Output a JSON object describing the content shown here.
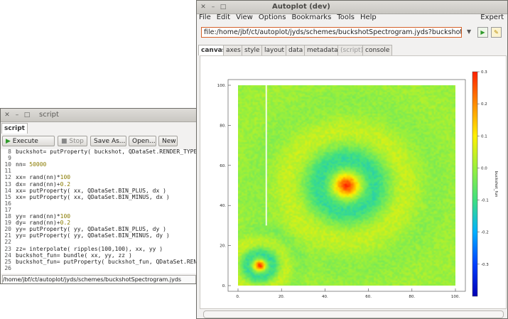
{
  "script_window": {
    "title": "script",
    "tab_label": "script",
    "buttons": {
      "execute": "Execute",
      "stop": "Stop",
      "save_as": "Save As...",
      "open": "Open...",
      "new": "New"
    },
    "code_lines": [
      {
        "n": "8",
        "text": "buckshot= putProperty( buckshot, QDataSet.RENDER_TYPE"
      },
      {
        "n": "9",
        "text": ""
      },
      {
        "n": "10",
        "text": "nn= 50000"
      },
      {
        "n": "11",
        "text": ""
      },
      {
        "n": "12",
        "text": "xx= rand(nn)*100"
      },
      {
        "n": "13",
        "text": "dx= rand(nn)+0.2"
      },
      {
        "n": "14",
        "text": "xx= putProperty( xx, QDataSet.BIN_PLUS, dx )"
      },
      {
        "n": "15",
        "text": "xx= putProperty( xx, QDataSet.BIN_MINUS, dx )"
      },
      {
        "n": "16",
        "text": ""
      },
      {
        "n": "17",
        "text": ""
      },
      {
        "n": "18",
        "text": "yy= rand(nn)*100"
      },
      {
        "n": "19",
        "text": "dy= rand(nn)+0.2"
      },
      {
        "n": "20",
        "text": "yy= putProperty( yy, QDataSet.BIN_PLUS, dy )"
      },
      {
        "n": "21",
        "text": "yy= putProperty( yy, QDataSet.BIN_MINUS, dy )"
      },
      {
        "n": "22",
        "text": ""
      },
      {
        "n": "23",
        "text": "zz= interpolate( ripples(100,100), xx, yy )"
      },
      {
        "n": "24",
        "text": "buckshot_fun= bundle( xx, yy, zz )"
      },
      {
        "n": "25",
        "text": "buckshot_fun= putProperty( buckshot_fun, QDataSet.REN"
      },
      {
        "n": "26",
        "text": ""
      }
    ],
    "status_path": "/home/jbf/ct/autoplot/jyds/schemes/buckshotSpectrogram.jyds"
  },
  "autoplot_window": {
    "title": "Autoplot (dev)",
    "menu": [
      "File",
      "Edit",
      "View",
      "Options",
      "Bookmarks",
      "Tools",
      "Help"
    ],
    "expert_label": "Expert",
    "address_value": "file:/home/jbf/ct/autoplot/jyds/schemes/buckshotSpectrogram.jyds?buckshot_fun",
    "tabs": [
      {
        "label": "canvas",
        "active": true,
        "disabled": false
      },
      {
        "label": "axes",
        "active": false,
        "disabled": false
      },
      {
        "label": "style",
        "active": false,
        "disabled": false
      },
      {
        "label": "layout",
        "active": false,
        "disabled": false
      },
      {
        "label": "data",
        "active": false,
        "disabled": false
      },
      {
        "label": "metadata",
        "active": false,
        "disabled": false
      },
      {
        "label": "(script)",
        "active": false,
        "disabled": true
      },
      {
        "label": "console",
        "active": false,
        "disabled": false
      }
    ]
  },
  "chart_data": {
    "type": "heatmap",
    "x_ticks": [
      "0.",
      "20.",
      "40.",
      "60.",
      "80.",
      "100."
    ],
    "y_ticks": [
      "0.",
      "20.",
      "40.",
      "60.",
      "80.",
      "100."
    ],
    "xlim": [
      0,
      100
    ],
    "ylim": [
      0,
      100
    ],
    "zlabel": "buckshot_fun",
    "zlim": [
      -0.4,
      0.3
    ],
    "z_ticks": [
      "0.3",
      "0.2",
      "0.1",
      "0.0",
      "-0.1",
      "-0.2",
      "-0.3"
    ],
    "colormap": [
      "#0000b4",
      "#0040ff",
      "#00b0ff",
      "#40e080",
      "#9af03c",
      "#fff000",
      "#ff8c00",
      "#ff2000"
    ],
    "features": [
      {
        "center_x": 50,
        "center_y": 50,
        "peak": 0.3
      },
      {
        "center_x": 10,
        "center_y": 10,
        "peak": 0.3
      }
    ]
  }
}
